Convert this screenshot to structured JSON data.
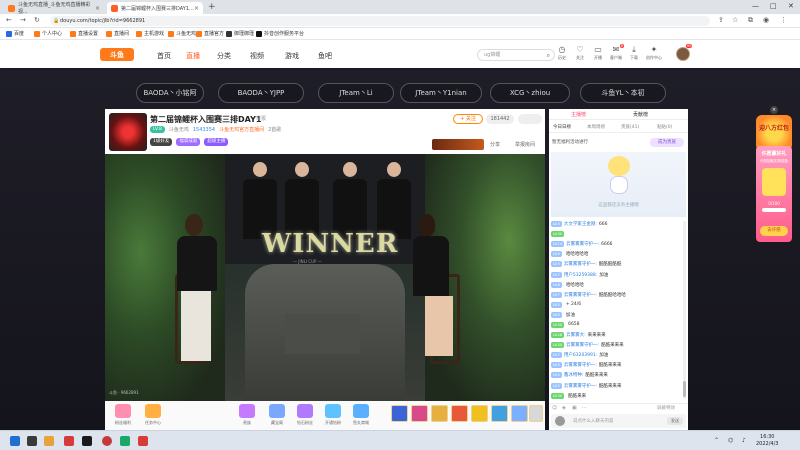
{
  "browser": {
    "tabs": [
      {
        "label": "斗鱼无鸡直播_斗鱼无鸡直播精彩视...",
        "fav_color": "#ff7a1a"
      },
      {
        "label": "第二届锦鲤杯入围赛三排DAY1...",
        "fav_color": "#ff5d23"
      }
    ],
    "url": "douyu.com/topic/jlb?rid=9662891",
    "bookmarks": [
      "百度",
      "个人中心",
      "直播设置",
      "直播间",
      "主机游戏",
      "斗鱼无鸡",
      "直播官方",
      "御瑾御瑾",
      "抖音创作服务平台"
    ]
  },
  "site": {
    "logo": "斗鱼",
    "nav": [
      "首页",
      "直播",
      "分类",
      "视频",
      "游戏",
      "鱼吧"
    ],
    "active_nav": "直播",
    "search_placeholder": "ug锦鲤",
    "header_icons": [
      {
        "icon": "history-icon",
        "label": "历史"
      },
      {
        "icon": "follow-icon",
        "label": "关注",
        "badge": ""
      },
      {
        "icon": "video-icon",
        "label": "开播"
      },
      {
        "icon": "message-icon",
        "label": "客户端",
        "badge": "6"
      },
      {
        "icon": "download-icon",
        "label": "下载"
      },
      {
        "icon": "creator-icon",
        "label": "创作中心"
      }
    ],
    "user_badge": "99"
  },
  "team_tags": {
    "partial": [
      "",
      "",
      "",
      ""
    ],
    "row": [
      "BAODA丶小铭阿",
      "BAODA丶YJPP",
      "JTeam丶Li",
      "JTeam丶Y1nian",
      "XCG丶zhiou",
      "斗鱼YL丶本初"
    ]
  },
  "room": {
    "title": "第二届锦鲤杯入围赛三排DAY1",
    "tag": "举报",
    "sub": [
      "斗鱼无鸡",
      "1543354",
      "斗鱼无鸡官方直播间",
      "2首歌"
    ],
    "level_pill": "LV.8",
    "btns": [
      "1级好友",
      "福袋成就",
      "超级主播"
    ],
    "follow_label": "+ 关注",
    "follow_count": "181442",
    "share_label": "分享",
    "report_label": "举报房间",
    "video_caption": "斗鱼 · 9662891",
    "winner_text": "WINNER",
    "winner_sub": "— JINLI CUP —",
    "gifts_left": [
      {
        "label": "粉丝福利",
        "color": "#ff8fb0"
      },
      {
        "label": "任务中心",
        "color": "#ffb040"
      }
    ],
    "gifts_mid": [
      {
        "label": "贵族",
        "color": "#c67aff"
      },
      {
        "label": "藏宝阁",
        "color": "#7aa8ff"
      },
      {
        "label": "钻石粉丝",
        "color": "#b07aff"
      },
      {
        "label": "开通钻粉",
        "color": "#5ec2ff"
      },
      {
        "label": "鱼丸商城",
        "color": "#5ab0ff"
      }
    ],
    "gift_items": [
      "#3a64d8",
      "#d84a8a",
      "#e6b040",
      "#e65a3a",
      "#f0c020",
      "#40a0e0",
      "#7ab0ff",
      "#d8d8d8"
    ]
  },
  "chat": {
    "tabs": [
      "主播榜",
      "贡献榜"
    ],
    "subtabs": [
      "今日日榜",
      "本周周榜",
      "贵族(41)",
      "贴贴(0)"
    ],
    "banner_text": "暂无福利活动进行",
    "banner_btn": "成为贵族",
    "empty_text": "这里都还没有主播哦",
    "messages": [
      {
        "lv": "LV.3",
        "lvc": "#9bc4ff",
        "user": "大文学家王金刚:",
        "text": "666"
      },
      {
        "lv": "LV.30",
        "lvc": "#6bd66b",
        "user": "",
        "text": ""
      },
      {
        "lv": "LV.14",
        "lvc": "#9bc4ff",
        "user": "云雾雾雾守护一:",
        "text": "6666"
      },
      {
        "lv": "LV.9",
        "lvc": "#9bc4ff",
        "user": "",
        "text": "哈哈哈哈哈"
      },
      {
        "lv": "LV.3",
        "lvc": "#9bc4ff",
        "user": "云雾雾雾守护一:",
        "text": "酷酷酷酷酷"
      },
      {
        "lv": "LV.7",
        "lvc": "#9bc4ff",
        "user": "用户53259388:",
        "text": "加油"
      },
      {
        "lv": "LV.8",
        "lvc": "#9bc4ff",
        "user": "",
        "text": "哈哈哈哈"
      },
      {
        "lv": "LV.7",
        "lvc": "#9bc4ff",
        "user": "云雾雾雾守护一:",
        "text": "酷酷酷哈哈哈"
      },
      {
        "lv": "LV.3",
        "lvc": "#9bc4ff",
        "user": "",
        "text": "+ 24/6"
      },
      {
        "lv": "LV.3",
        "lvc": "#9bc4ff",
        "user": "",
        "text": "加油"
      },
      {
        "lv": "LV.30",
        "lvc": "#6bd66b",
        "user": "",
        "text": "6658"
      },
      {
        "lv": "LV.28",
        "lvc": "#6bd66b",
        "user": "云雾雾大:",
        "text": "来来来来"
      },
      {
        "lv": "LV.30",
        "lvc": "#6bd66b",
        "user": "云雾雾雾守护一:",
        "text": "酷酷来来来"
      },
      {
        "lv": "LV.7",
        "lvc": "#9bc4ff",
        "user": "用户63203991:",
        "text": "加油"
      },
      {
        "lv": "LV.3",
        "lvc": "#9bc4ff",
        "user": "云雾雾雾守护一:",
        "text": "酷酷来来来"
      },
      {
        "lv": "LV.5",
        "lvc": "#9bc4ff",
        "user": "鑫冰特种:",
        "text": "酷酷来来来"
      },
      {
        "lv": "LV.3",
        "lvc": "#9bc4ff",
        "user": "云雾雾雾守护一:",
        "text": "酷酷来来来"
      },
      {
        "lv": "LV.30",
        "lvc": "#6bd66b",
        "user": "",
        "text": "酷酷来来"
      },
      {
        "lv": "LV.3",
        "lvc": "#9bc4ff",
        "user": "云雾雾雾守护一:",
        "text": "酷酷来来来"
      },
      {
        "lv": "LV.3",
        "lvc": "#9bc4ff",
        "user": "用户65322970:",
        "text": "加油"
      }
    ],
    "tool_right": "屏蔽特效",
    "input_placeholder": "说点什么入聊天内容",
    "send_label": "发送"
  },
  "floats": {
    "top": "迎八方红包",
    "card_title": "许愿赢好礼",
    "card_sub": "许愿抽取实物奖励",
    "card_count": "0/100",
    "card_btn": "去许愿"
  },
  "taskbar": {
    "icons": [
      "#1f6fd1",
      "#3a3a3a",
      "#e6a33a",
      "#d63a3a",
      "#1a1a1a",
      "#1a4fa8",
      "#1aa86a",
      "#d83a3a",
      "#444"
    ],
    "time": "16:30",
    "date": "2022/4/3"
  }
}
